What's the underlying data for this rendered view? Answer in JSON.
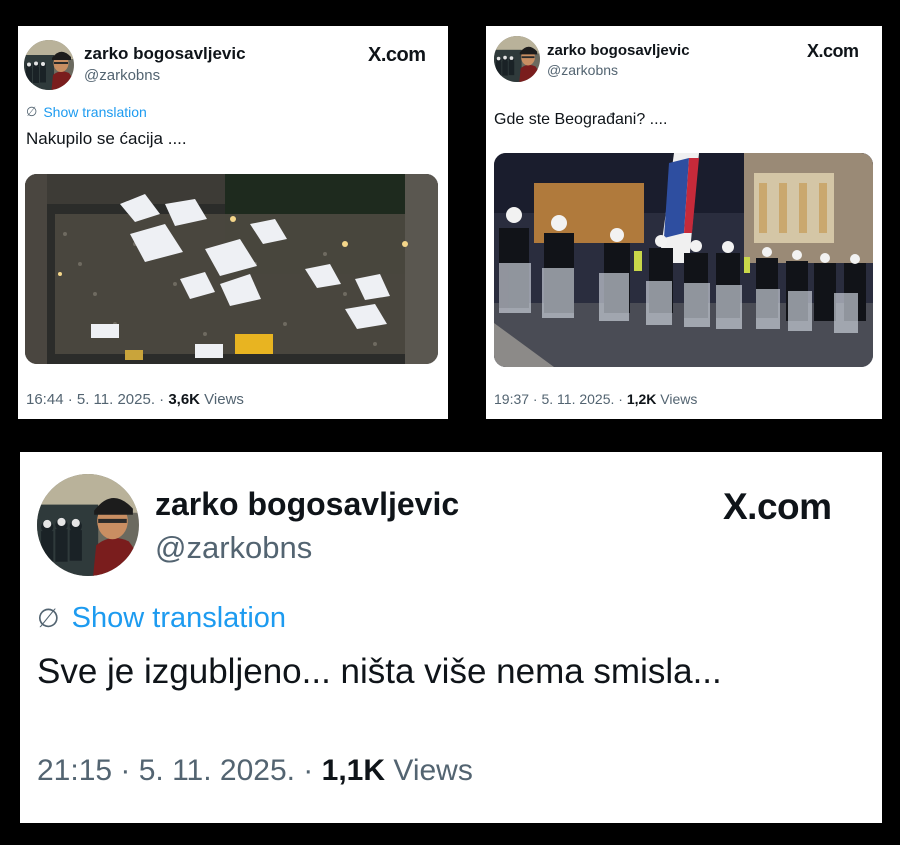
{
  "tweets": [
    {
      "author": "zarko bogosavljevic",
      "handle": "@zarkobns",
      "brand": "X.com",
      "translate_label": "Show translation",
      "text": "Nakupilo se ćacija ....",
      "time": "16:44 · 5. 11. 2025. · ",
      "views_count": "3,6K",
      "views_label": " Views",
      "media": "photo of a crowd with white tents on a street at night"
    },
    {
      "author": "zarko bogosavljevic",
      "handle": "@zarkobns",
      "brand": "X.com",
      "text": "Gde ste Beograđani? ....",
      "time": "19:37 · 5. 11. 2025. · ",
      "views_count": "1,2K",
      "views_label": " Views",
      "media": "photo of riot police line with shields at night"
    },
    {
      "author": "zarko bogosavljevic",
      "handle": "@zarkobns",
      "brand": "X.com",
      "translate_label": "Show translation",
      "text": "Sve je izgubljeno... ništa više nema smisla...",
      "time": "21:15 · 5. 11. 2025. · ",
      "views_count": "1,1K",
      "views_label": " Views"
    }
  ],
  "colors": {
    "background": "#000000",
    "card": "#ffffff",
    "text": "#0f1419",
    "secondary": "#536471",
    "link": "#1d9bf0"
  },
  "icons": [
    "translate-icon",
    "x-logo"
  ]
}
